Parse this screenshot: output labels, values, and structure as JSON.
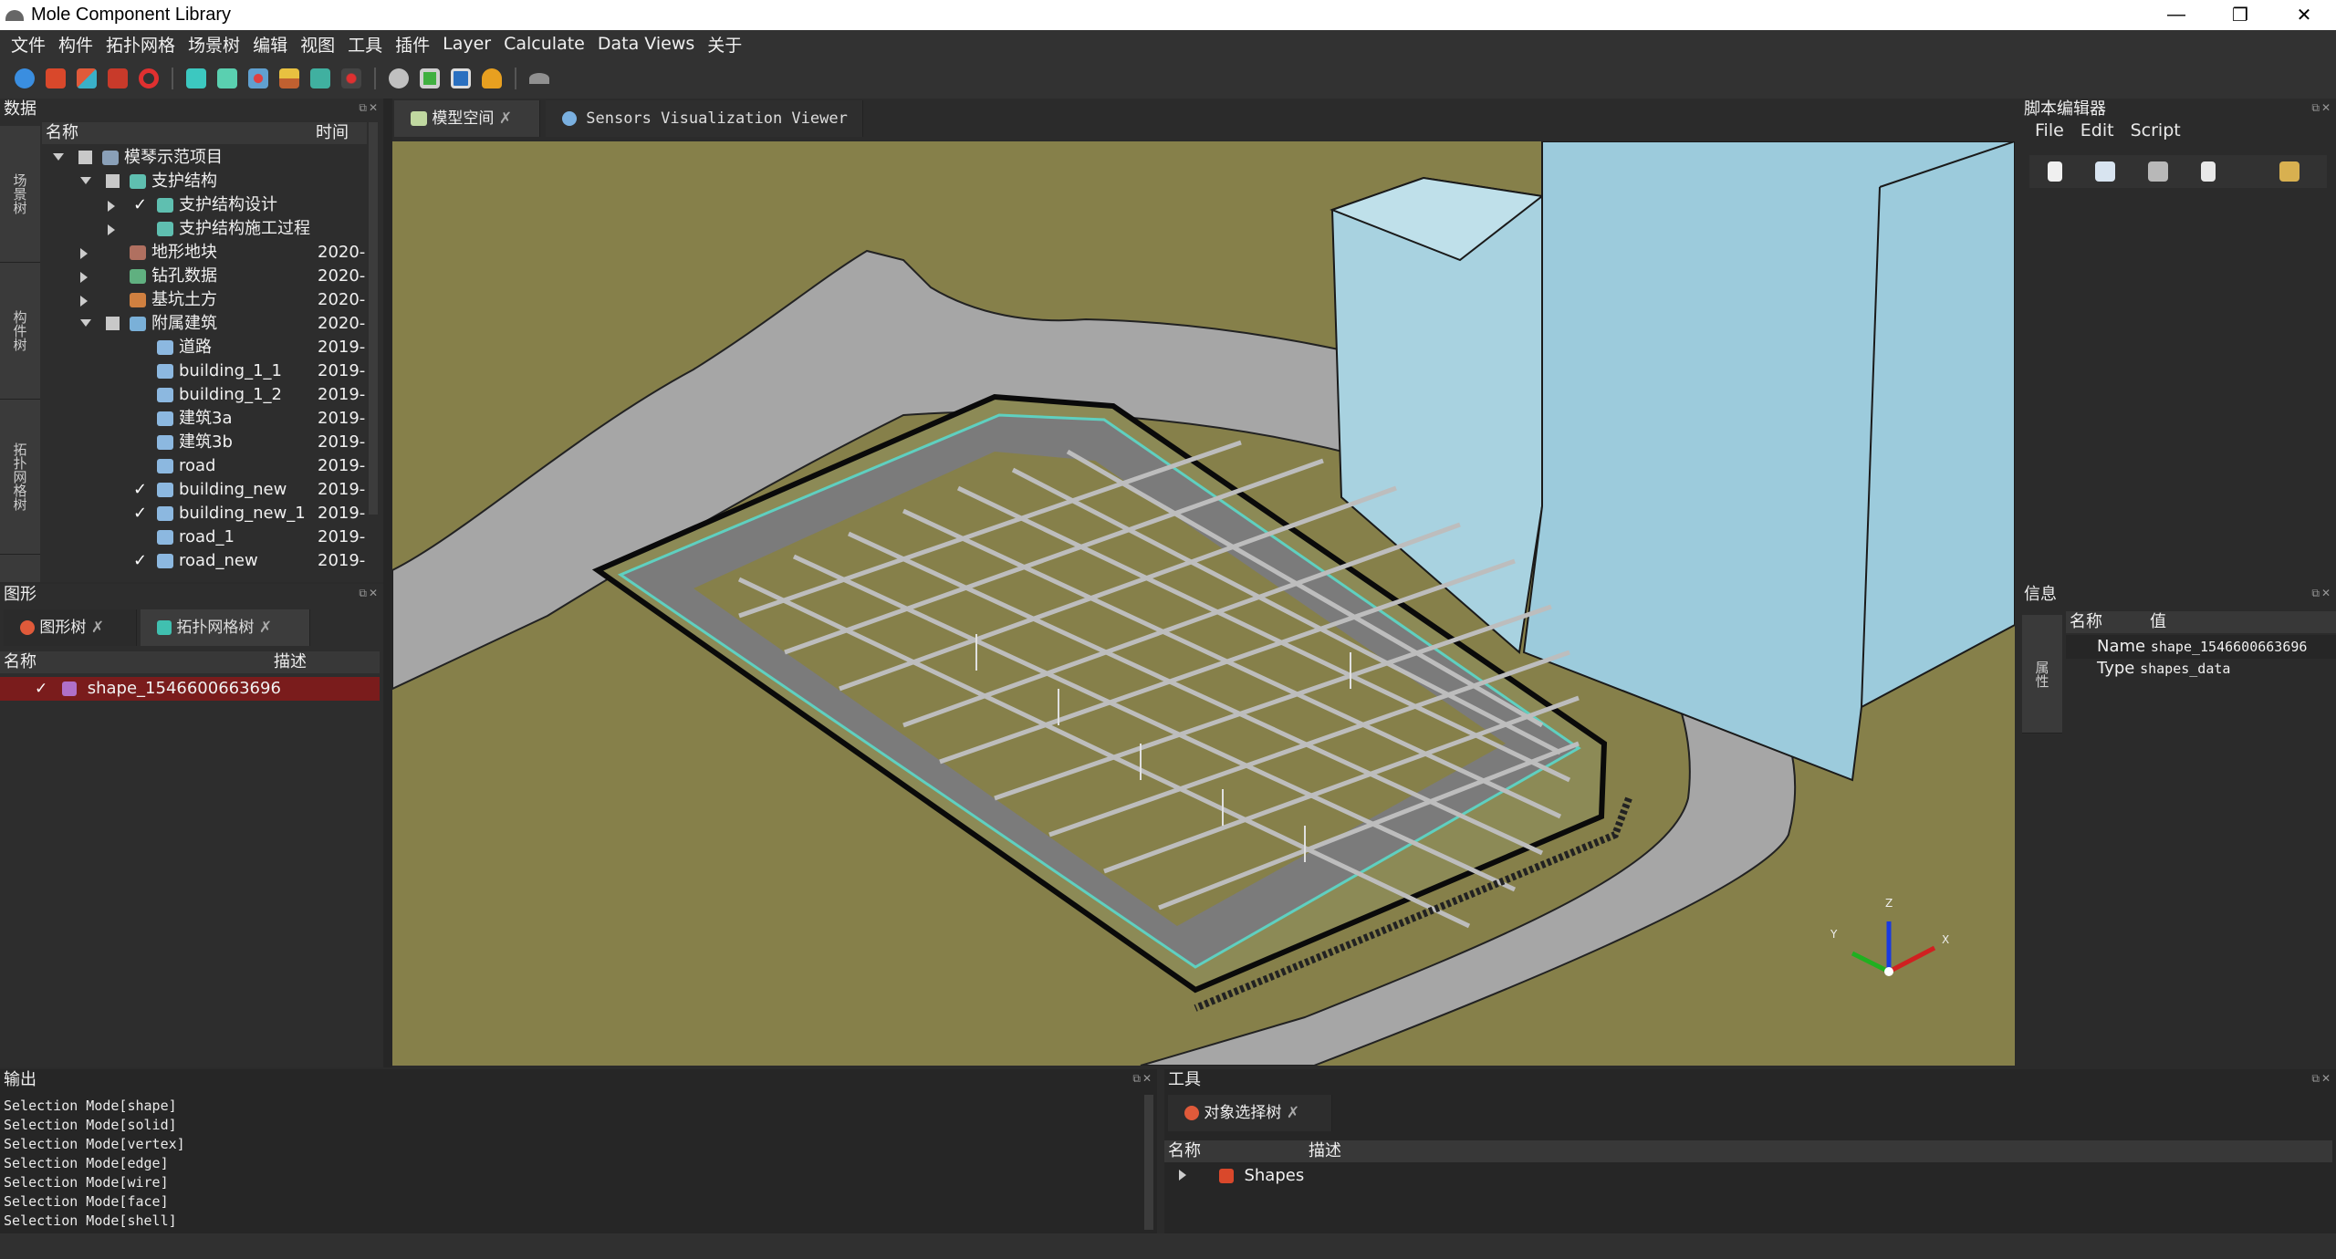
{
  "window": {
    "title": "Mole Component Library",
    "minimize": "—",
    "restore": "❐",
    "close": "✕"
  },
  "menu": [
    "文件",
    "构件",
    "拓扑网格",
    "场景树",
    "编辑",
    "视图",
    "工具",
    "插件",
    "Layer",
    "Calculate",
    "Data Views",
    "关于"
  ],
  "toolbar_icons": [
    "refresh-icon",
    "cube-red-icon",
    "cube-multi-icon",
    "cubes-red-icon",
    "ring-red-icon",
    "hex-cyan-icon",
    "hex-cyan2-icon",
    "atom-icon",
    "terrain-icon",
    "mesh-icon",
    "model-link-icon",
    "gear-icon",
    "screen-green-icon",
    "monitor-icon",
    "lamp-icon",
    "eye-icon"
  ],
  "data_panel": {
    "title": "数据",
    "col_name": "名称",
    "col_time": "时间",
    "side_tabs": [
      "场景树",
      "构件树",
      "拓扑网格树"
    ],
    "rows": [
      {
        "label": "模琴示范项目",
        "time": "",
        "indent": 0,
        "expand": "down",
        "check": "box",
        "icon": "#8aa0b8"
      },
      {
        "label": "支护结构",
        "time": "",
        "indent": 1,
        "expand": "down",
        "check": "box",
        "icon": "#5fbfb0"
      },
      {
        "label": "支护结构设计",
        "time": "",
        "indent": 2,
        "expand": "right",
        "check": "✓",
        "icon": "#5fbfb0"
      },
      {
        "label": "支护结构施工过程",
        "time": "",
        "indent": 2,
        "expand": "right",
        "check": "",
        "icon": "#5fbfb0"
      },
      {
        "label": "地形地块",
        "time": "2020-",
        "indent": 1,
        "expand": "right",
        "check": "",
        "icon": "#b07060"
      },
      {
        "label": "钻孔数据",
        "time": "2020-",
        "indent": 1,
        "expand": "right",
        "check": "",
        "icon": "#60b080"
      },
      {
        "label": "基坑土方",
        "time": "2020-",
        "indent": 1,
        "expand": "right",
        "check": "",
        "icon": "#d08040"
      },
      {
        "label": "附属建筑",
        "time": "2020-",
        "indent": 1,
        "expand": "down",
        "check": "box",
        "icon": "#7ab0d8"
      },
      {
        "label": "道路",
        "time": "2019-",
        "indent": 2,
        "expand": "",
        "check": "",
        "icon": "#8cb8e0"
      },
      {
        "label": "building_1_1",
        "time": "2019-",
        "indent": 2,
        "expand": "",
        "check": "",
        "icon": "#8cb8e0"
      },
      {
        "label": "building_1_2",
        "time": "2019-",
        "indent": 2,
        "expand": "",
        "check": "",
        "icon": "#8cb8e0"
      },
      {
        "label": "建筑3a",
        "time": "2019-",
        "indent": 2,
        "expand": "",
        "check": "",
        "icon": "#8cb8e0"
      },
      {
        "label": "建筑3b",
        "time": "2019-",
        "indent": 2,
        "expand": "",
        "check": "",
        "icon": "#8cb8e0"
      },
      {
        "label": "road",
        "time": "2019-",
        "indent": 2,
        "expand": "",
        "check": "",
        "icon": "#8cb8e0"
      },
      {
        "label": "building_new",
        "time": "2019-",
        "indent": 2,
        "expand": "",
        "check": "✓",
        "icon": "#8cb8e0"
      },
      {
        "label": "building_new_1",
        "time": "2019-",
        "indent": 2,
        "expand": "",
        "check": "✓",
        "icon": "#8cb8e0"
      },
      {
        "label": "road_1",
        "time": "2019-",
        "indent": 2,
        "expand": "",
        "check": "",
        "icon": "#8cb8e0"
      },
      {
        "label": "road_new",
        "time": "2019-",
        "indent": 2,
        "expand": "",
        "check": "✓",
        "icon": "#8cb8e0"
      }
    ]
  },
  "shape_panel": {
    "title": "图形",
    "tabs": [
      "图形树",
      "拓扑网格树"
    ],
    "col_name": "名称",
    "col_desc": "描述",
    "row": {
      "check": "✓",
      "label": "shape_1546600663696"
    }
  },
  "view_tabs": [
    "模型空间",
    "Sensors Visualization Viewer"
  ],
  "axes": {
    "z": "Z",
    "y": "Y",
    "x": "X"
  },
  "script_panel": {
    "title": "脚本编辑器",
    "menu": [
      "File",
      "Edit",
      "Script"
    ]
  },
  "info_panel": {
    "title": "信息",
    "col_name": "名称",
    "col_value": "值",
    "side_tab": "属性",
    "rows": [
      {
        "key": "Name",
        "value": "shape_1546600663696"
      },
      {
        "key": "Type",
        "value": "shapes_data"
      }
    ]
  },
  "output_panel": {
    "title": "输出",
    "lines": [
      "Selection Mode[shape]",
      "Selection Mode[solid]",
      "Selection Mode[vertex]",
      "Selection Mode[edge]",
      "Selection Mode[wire]",
      "Selection Mode[face]",
      "Selection Mode[shell]"
    ]
  },
  "tools_panel": {
    "title": "工具",
    "tab": "对象选择树",
    "col_name": "名称",
    "col_desc": "描述",
    "row_label": "Shapes"
  },
  "colors": {
    "ground": "#86804a",
    "road": "#a6a6a6",
    "building": "#a7d3e0",
    "selection": "#7a1c1c"
  }
}
